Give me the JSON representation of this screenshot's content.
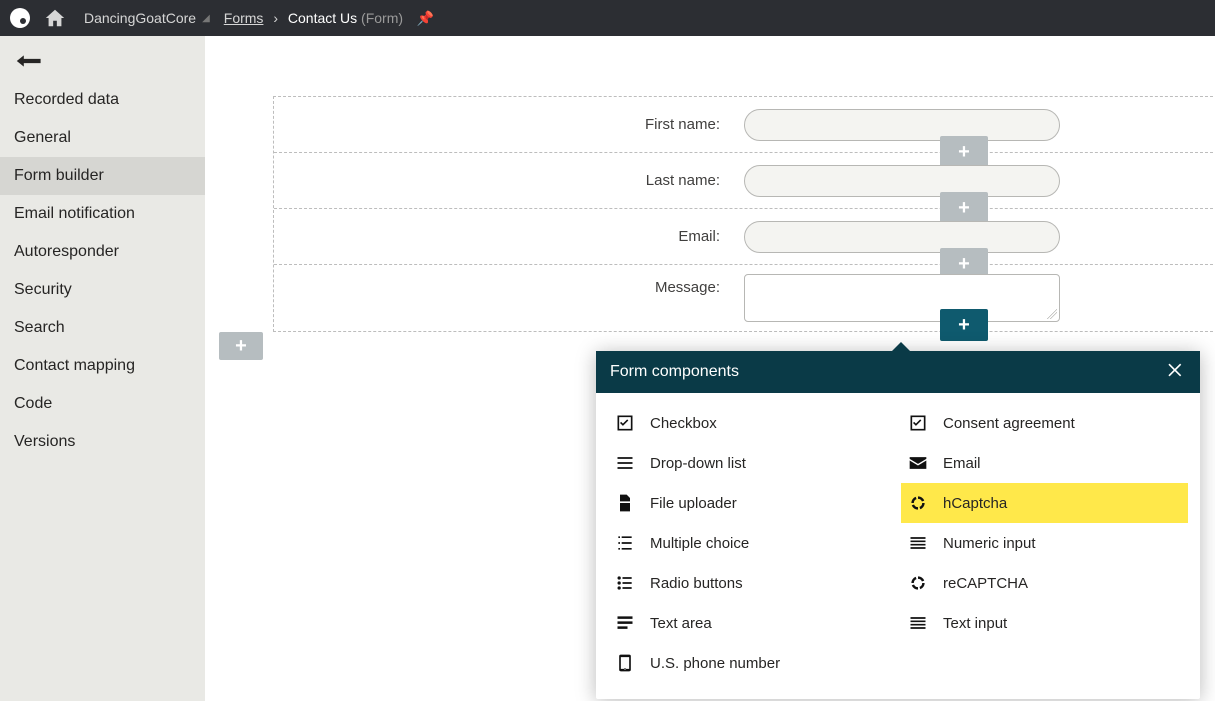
{
  "topbar": {
    "site": "DancingGoatCore",
    "crumb_root": "Forms",
    "crumb_title": "Contact Us",
    "crumb_type": "(Form)"
  },
  "sidebar": {
    "items": [
      {
        "label": "Recorded data",
        "selected": false
      },
      {
        "label": "General",
        "selected": false
      },
      {
        "label": "Form builder",
        "selected": true
      },
      {
        "label": "Email notification",
        "selected": false
      },
      {
        "label": "Autoresponder",
        "selected": false
      },
      {
        "label": "Security",
        "selected": false
      },
      {
        "label": "Search",
        "selected": false
      },
      {
        "label": "Contact mapping",
        "selected": false
      },
      {
        "label": "Code",
        "selected": false
      },
      {
        "label": "Versions",
        "selected": false
      }
    ]
  },
  "fields": {
    "first_name_label": "First name:",
    "last_name_label": "Last name:",
    "email_label": "Email:",
    "message_label": "Message:"
  },
  "popover": {
    "title": "Form components",
    "left": [
      {
        "icon": "checkbox",
        "label": "Checkbox"
      },
      {
        "icon": "dropdown",
        "label": "Drop-down list"
      },
      {
        "icon": "file",
        "label": "File uploader"
      },
      {
        "icon": "multiple",
        "label": "Multiple choice"
      },
      {
        "icon": "radio",
        "label": "Radio buttons"
      },
      {
        "icon": "textarea",
        "label": "Text area"
      },
      {
        "icon": "phone",
        "label": "U.S. phone number"
      }
    ],
    "right": [
      {
        "icon": "checkbox",
        "label": "Consent agreement",
        "hl": false
      },
      {
        "icon": "email",
        "label": "Email",
        "hl": false
      },
      {
        "icon": "recaptcha",
        "label": "hCaptcha",
        "hl": true
      },
      {
        "icon": "textinput",
        "label": "Numeric input",
        "hl": false
      },
      {
        "icon": "recaptcha",
        "label": "reCAPTCHA",
        "hl": false
      },
      {
        "icon": "textinput",
        "label": "Text input",
        "hl": false
      }
    ]
  }
}
